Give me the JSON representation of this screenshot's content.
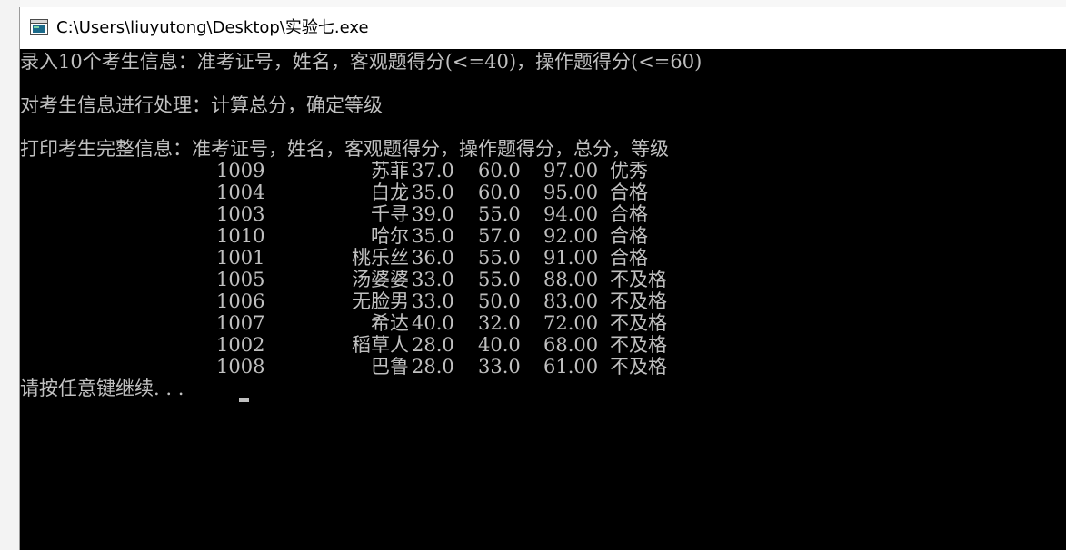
{
  "window": {
    "title": "C:\\Users\\liuyutong\\Desktop\\实验七.exe"
  },
  "console": {
    "line1": "录入10个考生信息：准考证号，姓名，客观题得分(<=40)，操作题得分(<=60)",
    "line2": "对考生信息进行处理：计算总分，确定等级",
    "line3": "打印考生完整信息：准考证号，姓名，客观题得分，操作题得分，总分，等级",
    "rows": [
      {
        "id": "1009",
        "name": "苏菲",
        "objective": "37.0",
        "operation": "60.0",
        "total": "97.00",
        "grade": "优秀"
      },
      {
        "id": "1004",
        "name": "白龙",
        "objective": "35.0",
        "operation": "60.0",
        "total": "95.00",
        "grade": "合格"
      },
      {
        "id": "1003",
        "name": "千寻",
        "objective": "39.0",
        "operation": "55.0",
        "total": "94.00",
        "grade": "合格"
      },
      {
        "id": "1010",
        "name": "哈尔",
        "objective": "35.0",
        "operation": "57.0",
        "total": "92.00",
        "grade": "合格"
      },
      {
        "id": "1001",
        "name": "桃乐丝",
        "objective": "36.0",
        "operation": "55.0",
        "total": "91.00",
        "grade": "合格"
      },
      {
        "id": "1005",
        "name": "汤婆婆",
        "objective": "33.0",
        "operation": "55.0",
        "total": "88.00",
        "grade": "不及格"
      },
      {
        "id": "1006",
        "name": "无脸男",
        "objective": "33.0",
        "operation": "50.0",
        "total": "83.00",
        "grade": "不及格"
      },
      {
        "id": "1007",
        "name": "希达",
        "objective": "40.0",
        "operation": "32.0",
        "total": "72.00",
        "grade": "不及格"
      },
      {
        "id": "1002",
        "name": "稻草人",
        "objective": "28.0",
        "operation": "40.0",
        "total": "68.00",
        "grade": "不及格"
      },
      {
        "id": "1008",
        "name": "巴鲁",
        "objective": "28.0",
        "operation": "33.0",
        "total": "61.00",
        "grade": "不及格"
      }
    ],
    "prompt": "请按任意键继续. . ."
  },
  "colors": {
    "console_background": "#000000",
    "console_text": "#c0c0c0",
    "titlebar_background": "#ffffff"
  },
  "icons": {
    "app": "console-window-icon"
  }
}
